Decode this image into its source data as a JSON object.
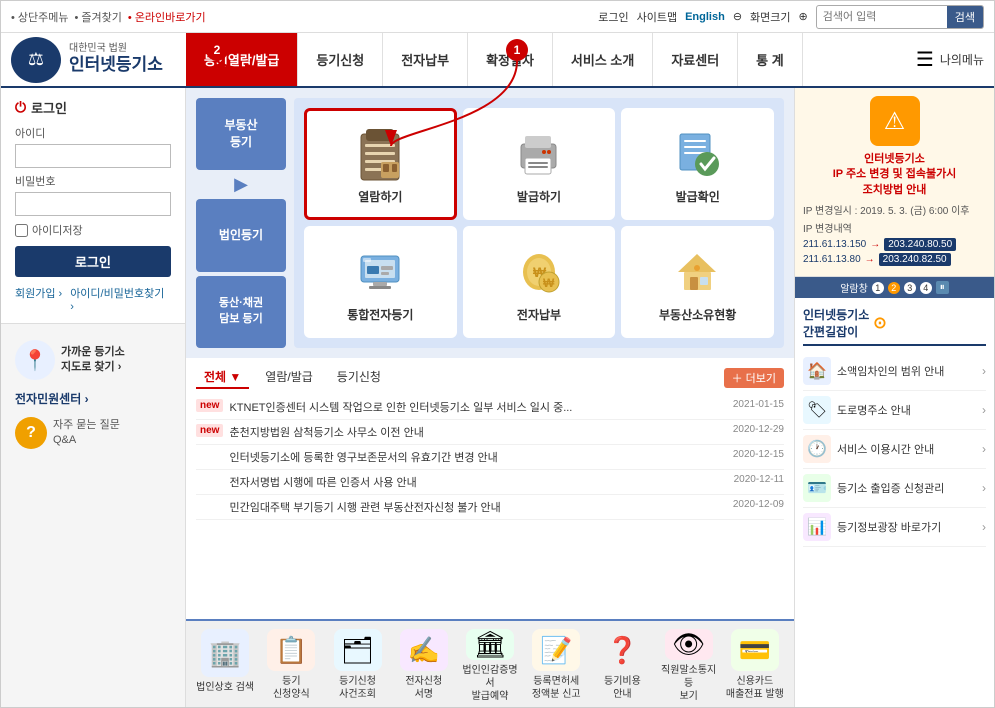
{
  "topbar": {
    "menu_items": [
      "상단주메뉴",
      "즐겨찾기",
      "온라인바로가기"
    ],
    "login": "로그인",
    "sitemap": "사이트맵",
    "english": "English",
    "screen_size": "화면크기",
    "search_placeholder": "검색어 입력",
    "search_btn": "검색"
  },
  "header": {
    "logo_line1": "대한민국 법원",
    "logo_line2": "인터넷등기소",
    "nav_items": [
      "등기열람/발급",
      "등기신청",
      "전자납부",
      "확정일자",
      "서비스 소개",
      "자료센터",
      "통 계"
    ],
    "my_menu": "나의메뉴"
  },
  "login_section": {
    "title": "로그인",
    "id_label": "아이디",
    "pw_label": "비밀번호",
    "remember": "아이디저장",
    "login_btn": "로그인",
    "join": "회원가입 ›",
    "find_account": "아이디/비밀번호찾기 ›"
  },
  "sidebar_left": {
    "nearby_title": "가까운 등기소\n지도로 찾기 ›",
    "electronic_service": "전자민원센터 ›",
    "qa_title": "자주 묻는 질문\nQ&A"
  },
  "service_categories": [
    {
      "label": "부동산\n등기",
      "active": false
    },
    {
      "label": "법인등기",
      "active": false
    },
    {
      "label": "동산·채권\n담보 등기",
      "active": false
    }
  ],
  "service_icons": [
    {
      "label": "열람하기",
      "icon": "clipboard",
      "highlighted": true
    },
    {
      "label": "발급하기",
      "icon": "printer",
      "highlighted": false
    },
    {
      "label": "발급확인",
      "icon": "checkmark",
      "highlighted": false
    },
    {
      "label": "통합전자등기",
      "icon": "monitor",
      "highlighted": false
    },
    {
      "label": "전자납부",
      "icon": "payment",
      "highlighted": false
    },
    {
      "label": "부동산소유현황",
      "icon": "house",
      "highlighted": false
    }
  ],
  "news": {
    "tabs": [
      "전체",
      "열람/발급",
      "등기신청"
    ],
    "active_tab": "전체",
    "more_btn": "더보기",
    "items": [
      {
        "badge": "new",
        "text": "KTNET인증센터 시스템 작업으로 인한 인터넷등기소 일부 서비스 일시 중...",
        "date": "2021-01-15"
      },
      {
        "badge": "new",
        "text": "춘천지방법원 삼척등기소 사무소 이전 안내",
        "date": "2020-12-29"
      },
      {
        "badge": "",
        "text": "인터넷등기소에 등록한 영구보존문서의 유효기간 변경 안내",
        "date": "2020-12-15"
      },
      {
        "badge": "",
        "text": "전자서명법 시행에 따른 인증서 사용 안내",
        "date": "2020-12-11"
      },
      {
        "badge": "",
        "text": "민간임대주택 부기등기 시행 관련 부동산전자신청 불가 안내",
        "date": "2020-12-09"
      }
    ]
  },
  "bottom_icons": [
    {
      "label": "법인상호\n검색",
      "icon": "🏢",
      "color": "#e8f0ff"
    },
    {
      "label": "등기\n신청양식",
      "icon": "📋",
      "color": "#fff0e8"
    },
    {
      "label": "등기신청\n사건조회",
      "icon": "🔍",
      "color": "#e8fff0"
    },
    {
      "label": "전자신청\n서명",
      "icon": "✍️",
      "color": "#f8e8ff"
    },
    {
      "label": "법인인감증명서\n발급예약",
      "icon": "🏛",
      "color": "#e8f8ff"
    },
    {
      "label": "등록면허세\n정액분 신고",
      "icon": "📝",
      "color": "#fff8e8"
    },
    {
      "label": "등기비용\n안내",
      "icon": "❓",
      "color": "#f0f0f0"
    },
    {
      "label": "직원말소통지등\n보기",
      "icon": "👁",
      "color": "#ffe8f0"
    },
    {
      "label": "신용카드\n매출전표 발행",
      "icon": "💳",
      "color": "#f0ffe8"
    }
  ],
  "alert": {
    "title": "인터넷등기소\nIP 주소 변경 및 접속불가시\n조치방법 안내",
    "date_label": "IP 변경일시 : 2019. 5. 3. (금) 6:00 이후",
    "changes_title": "IP 변경내역",
    "changes": [
      {
        "from": "211.61.13.150",
        "to": "203.240.80.50"
      },
      {
        "from": "211.61.13.80",
        "to": "203.240.82.50"
      }
    ],
    "nav_label": "알람창",
    "nav_pages": [
      "1",
      "2",
      "3",
      "4"
    ],
    "active_page": "2"
  },
  "shortcuts": {
    "title": "인터넷등기소\n간편길잡이",
    "items": [
      {
        "label": "소액임차인의 범위 안내",
        "icon": "🏠",
        "color": "#e8f0ff"
      },
      {
        "label": "도로명주소 안내",
        "icon": "🏷",
        "color": "#e8f8ff"
      },
      {
        "label": "서비스 이용시간 안내",
        "icon": "🕐",
        "color": "#fff0e8"
      },
      {
        "label": "등기소 출입증 신청관리",
        "icon": "🪪",
        "color": "#e8ffe8"
      },
      {
        "label": "등기정보광장 바로가기",
        "icon": "📊",
        "color": "#f8e8ff"
      }
    ]
  },
  "annotations": {
    "circle1": "1",
    "circle2": "2"
  }
}
